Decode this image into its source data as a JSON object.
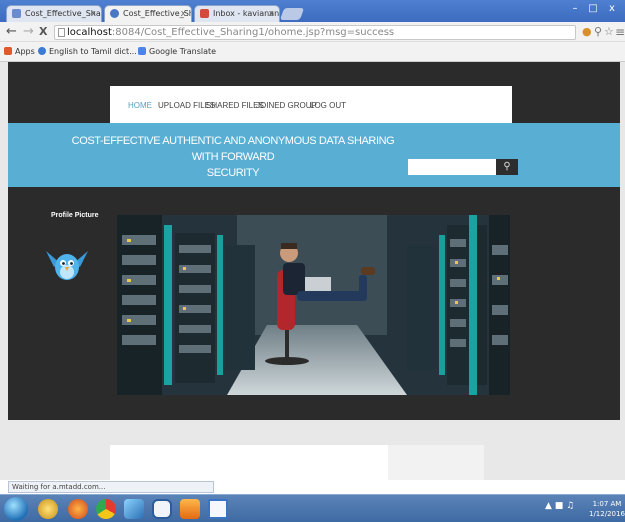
{
  "browser": {
    "tabs": [
      {
        "title": "Cost_Effective_Sharing",
        "close": "x",
        "favicon_color": "#6b8dc9"
      },
      {
        "title": "Cost_Effective_Sharing",
        "close": "x",
        "favicon_color": "#4a77c3"
      },
      {
        "title": "Inbox - kavianangan@...",
        "close": "x",
        "favicon_color": "#d44a3c"
      }
    ],
    "window_controls": [
      "–",
      "□",
      "x"
    ],
    "nav": {
      "back": "←",
      "forward": "→",
      "stop": "X"
    },
    "url_host": "localhost",
    "url_rest": ":8084/Cost_Effective_Sharing1/ohome.jsp?msg=success",
    "bookmarks": [
      {
        "label": "Apps",
        "color": "#e0592a"
      },
      {
        "label": "English to Tamil dict...",
        "color": "#3b7bd6"
      },
      {
        "label": "Google Translate",
        "color": "#4a86e8"
      }
    ],
    "status_text": "Waiting for a.mtadd.com..."
  },
  "site": {
    "menu": [
      "HOME",
      "UPLOAD FILES",
      "SHARED FILES",
      "JOINED GROUP",
      "LOG OUT"
    ],
    "title_line1": "COST-EFFECTIVE AUTHENTIC AND ANONYMOUS DATA SHARING WITH FORWARD",
    "title_line2": "SECURITY",
    "search_placeholder": "",
    "search_icon": "search-icon",
    "profile_label": "Profile Picture",
    "colors": {
      "banner": "#58aed3",
      "menu_active": "#5a9fc8",
      "dark_background": "#2b2b2b"
    }
  },
  "taskbar": {
    "clock_time": "1:07 AM",
    "clock_date": "1/12/2016",
    "apps": [
      "ie-icon",
      "explorer-icon",
      "firefox-icon",
      "chrome-icon",
      "eclipse-icon",
      "netbeans-icon",
      "mediaplayer-icon",
      "notepad-icon"
    ]
  }
}
